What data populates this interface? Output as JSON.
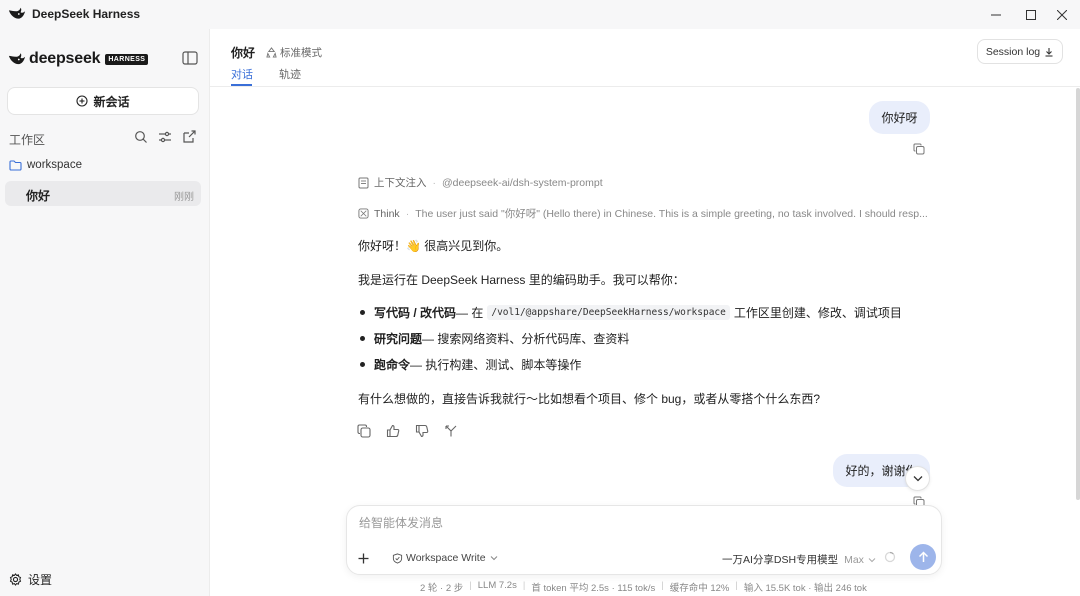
{
  "window": {
    "title": "DeepSeek Harness"
  },
  "sidebar": {
    "logo_text": "deepseek",
    "logo_badge": "HARNESS",
    "new_chat_label": "新会话",
    "workspace_label": "工作区",
    "folder_name": "workspace",
    "sessions": [
      {
        "title": "你好",
        "time": "刚刚"
      }
    ],
    "settings_label": "设置"
  },
  "header": {
    "title": "你好",
    "mode": "标准模式",
    "tabs": [
      {
        "label": "对话"
      },
      {
        "label": "轨迹"
      }
    ],
    "session_log_label": "Session log"
  },
  "chat": {
    "user_message_1": "你好呀",
    "context_label": "上下文注入",
    "context_source": "@deepseek-ai/dsh-system-prompt",
    "think_label": "Think",
    "think_text": "The user just said \"你好呀\" (Hello there) in Chinese. This is a simple greeting, no task involved. I should resp...",
    "greeting": "你好呀！👋 很高兴见到你。",
    "intro": "我是运行在 DeepSeek Harness 里的编码助手。我可以帮你：",
    "bullets": [
      {
        "bold": "写代码 / 改代码",
        "before_code": " — 在",
        "code": "/vol1/@appshare/DeepSeekHarness/workspace",
        "after_code": "工作区里创建、修改、调试项目"
      },
      {
        "bold": "研究问题",
        "text": " — 搜索网络资料、分析代码库、查资料"
      },
      {
        "bold": "跑命令",
        "text": " — 执行构建、测试、脚本等操作"
      }
    ],
    "closing": "有什么想做的，直接告诉我就行～比如想看个项目、修个 bug，或者从零搭个什么东西?",
    "user_message_2": "好的，谢谢你"
  },
  "composer": {
    "placeholder": "给智能体发消息",
    "permission": "Workspace Write",
    "model": "一万AI分享DSH专用模型",
    "effort": "Max"
  },
  "status_bar": [
    "2 轮 · 2 步",
    "LLM 7.2s",
    "首 token 平均 2.5s · 115 tok/s",
    "缓存命中 12%",
    "输入 15.5K tok · 输出 246 tok"
  ],
  "colors": {
    "accent": "#3a6fd8",
    "user_bubble": "#e9eefb",
    "send_button": "#9db5ea"
  }
}
